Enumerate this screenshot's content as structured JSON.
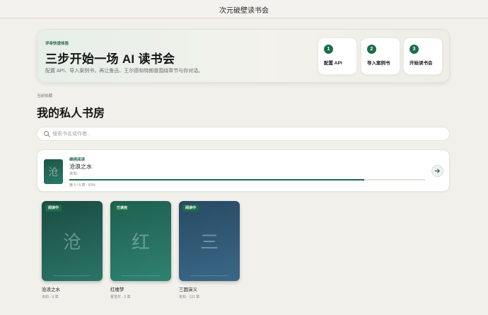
{
  "app": {
    "title": "次元破壁读书会"
  },
  "hero": {
    "eyebrow": "评审快速体验",
    "title": "三步开始一场 AI 读书会",
    "subtitle": "配置 API、导入案例书，再让鲁迅、王尔德和特朗普围绕章节与你对话。",
    "steps": [
      {
        "num": "1",
        "label": "配置 API"
      },
      {
        "num": "2",
        "label": "导入案例书"
      },
      {
        "num": "3",
        "label": "开始读书会"
      }
    ]
  },
  "library": {
    "eyebrow": "当前收藏",
    "title": "我的私人书房"
  },
  "search": {
    "placeholder": "搜索书名或作者..."
  },
  "continue_reading": {
    "eyebrow": "继续阅读",
    "cover_glyph": "沧",
    "title": "沧浪之水",
    "author": "未知",
    "progress_text": "第 5 / 6 章 · 83%",
    "progress_percent": 83
  },
  "books": [
    {
      "badge": "阅读中",
      "glyph": "沧",
      "title": "沧浪之水",
      "meta": "未知 · 6 章"
    },
    {
      "badge": "已读完",
      "glyph": "红",
      "title": "红楼梦",
      "meta": "曹雪芹 · 3 章"
    },
    {
      "badge": "阅读中",
      "glyph": "三",
      "title": "三国演义",
      "meta": "未知 · 121 章"
    }
  ],
  "colors": {
    "accent": "#1e6b4a",
    "background": "#f2f0eb"
  },
  "icons": {
    "search": "search-icon",
    "go": "arrow-right-icon"
  }
}
